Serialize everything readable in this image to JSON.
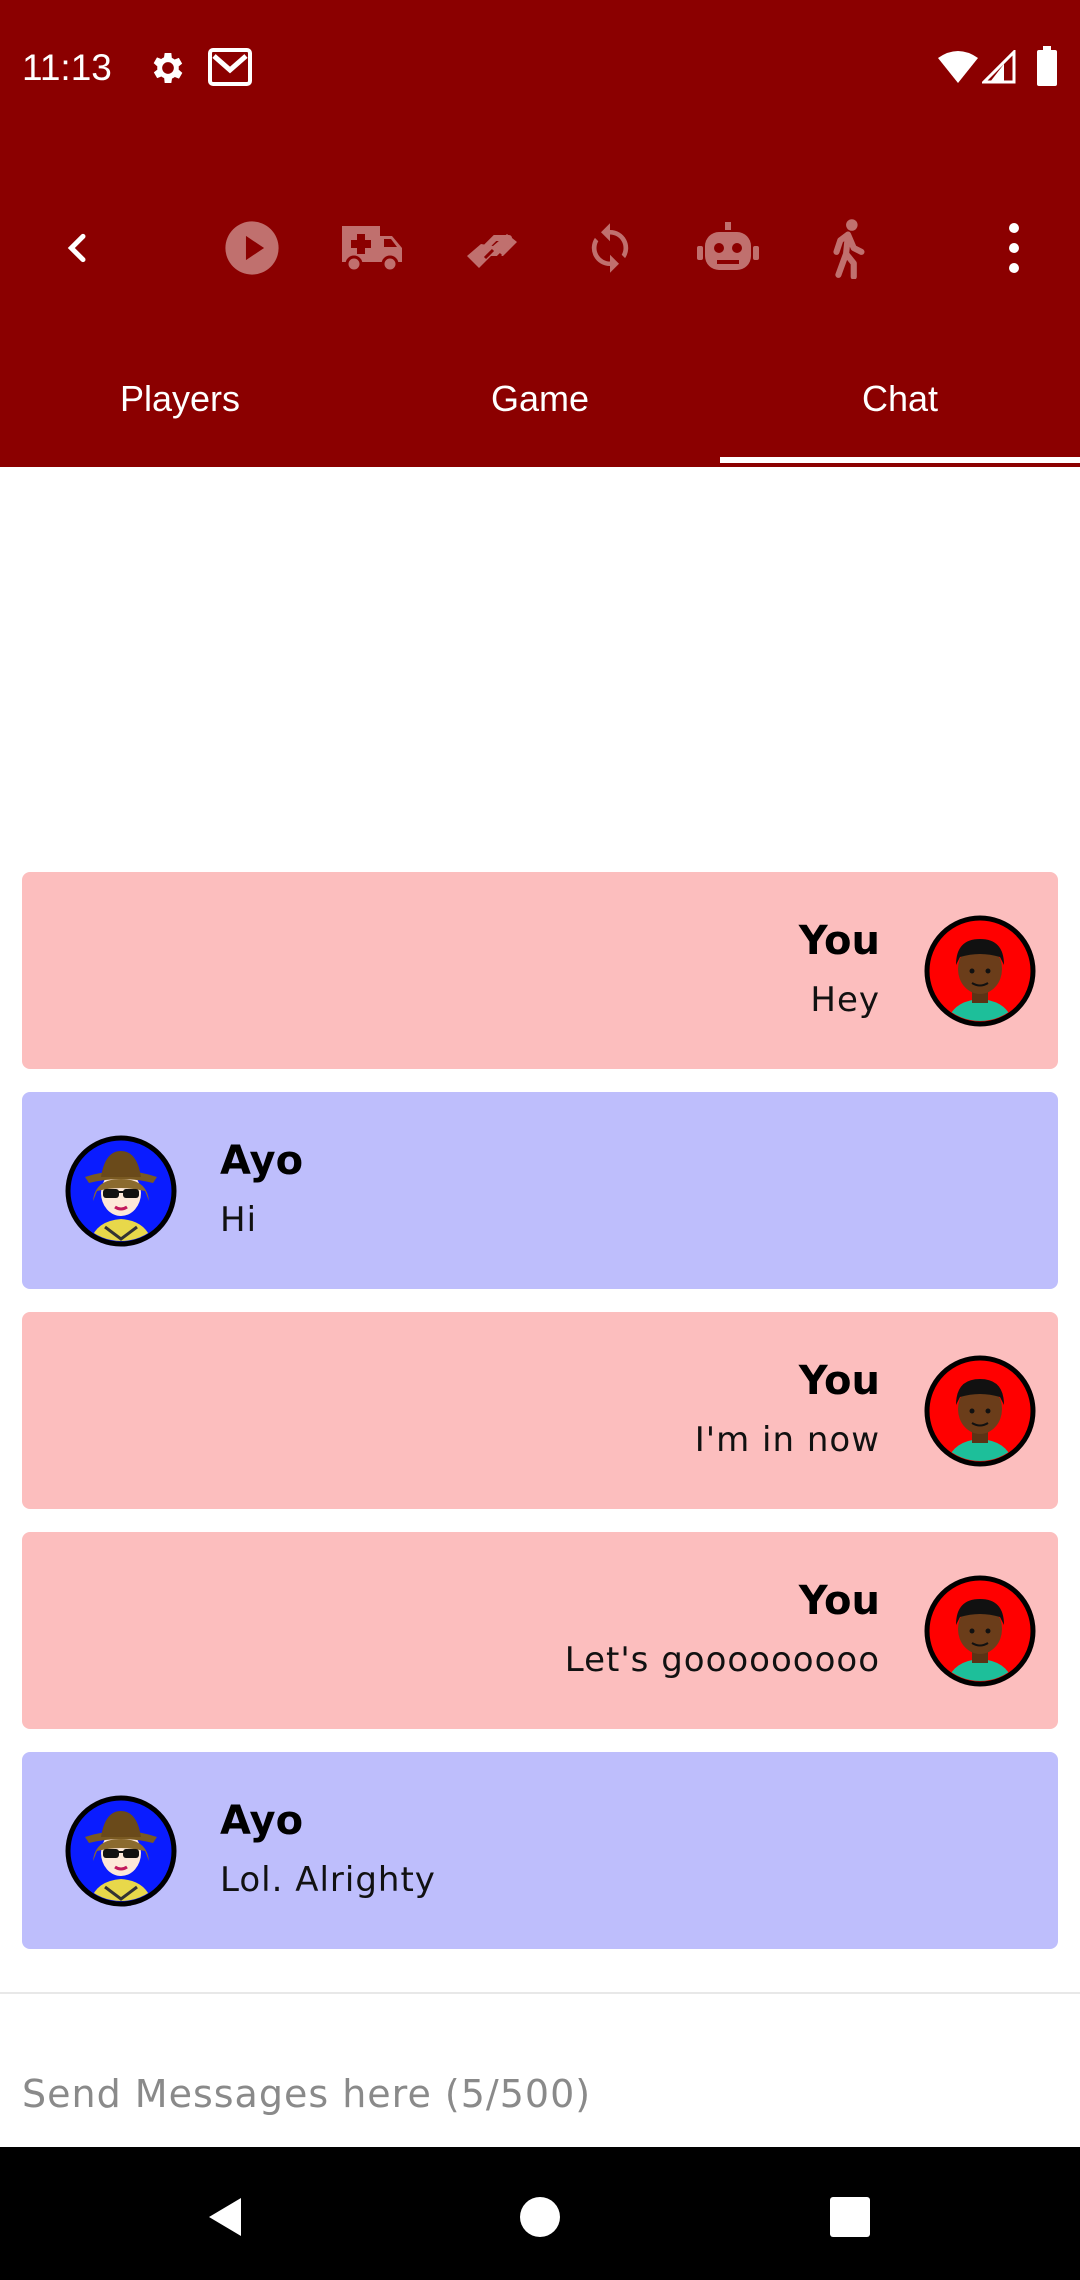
{
  "status_bar": {
    "time": "11:13",
    "left_icons": [
      "gear-icon",
      "gmail-icon"
    ],
    "right_icons": [
      "wifi-icon",
      "signal-icon",
      "battery-icon"
    ]
  },
  "toolbar": {
    "icons": [
      "back-arrow-icon",
      "play-icon",
      "ambulance-icon",
      "handshake-icon",
      "sync-icon",
      "robot-icon",
      "walking-icon",
      "more-vert-icon"
    ]
  },
  "tabs": [
    {
      "label": "Players",
      "selected": false
    },
    {
      "label": "Game",
      "selected": false
    },
    {
      "label": "Chat",
      "selected": true
    }
  ],
  "messages": [
    {
      "sender": "You",
      "text": "Hey",
      "own": true
    },
    {
      "sender": "Ayo",
      "text": "Hi",
      "own": false
    },
    {
      "sender": "You",
      "text": "I'm in now",
      "own": true
    },
    {
      "sender": "You",
      "text": "Let's gooooooooo",
      "own": true
    },
    {
      "sender": "Ayo",
      "text": "Lol. Alrighty",
      "own": false
    }
  ],
  "input": {
    "placeholder": "Send Messages here (5/500)",
    "value": ""
  },
  "colors": {
    "header": "#8b0000",
    "toolbar_icon": "#c0706e",
    "own_message": "#fcbebe",
    "other_message": "#bebefc",
    "own_avatar_bg": "#ff0000",
    "other_avatar_bg": "#0000ff"
  },
  "nav_bar": {
    "icons": [
      "back-triangle-icon",
      "home-circle-icon",
      "recents-square-icon"
    ]
  }
}
